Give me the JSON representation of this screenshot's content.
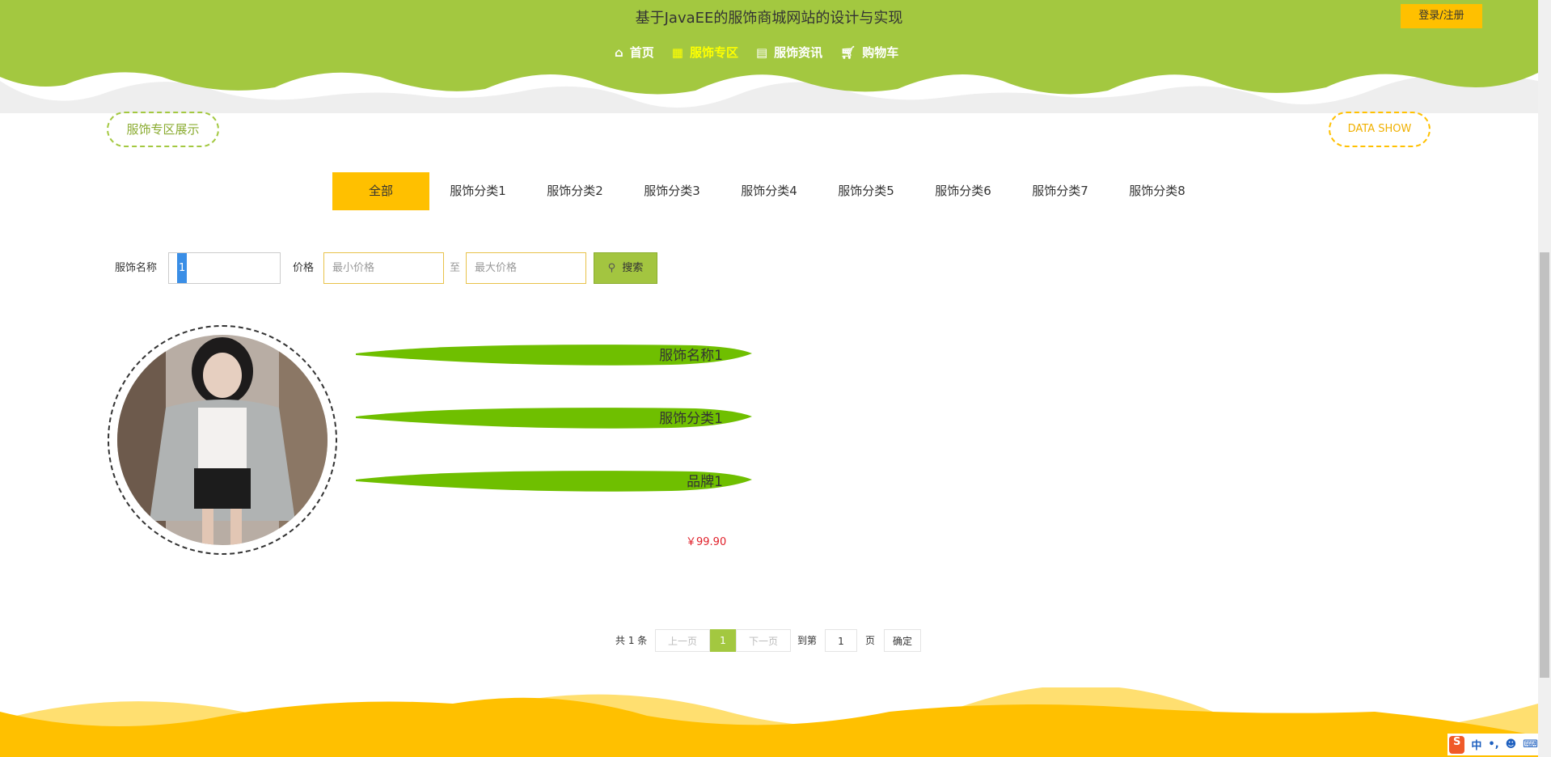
{
  "header": {
    "title": "基于JavaEE的服饰商城网站的设计与实现",
    "login": "登录/注册",
    "nav": [
      {
        "label": "首页",
        "icon": "home-icon"
      },
      {
        "label": "服饰专区",
        "icon": "grid-icon"
      },
      {
        "label": "服饰资讯",
        "icon": "news-icon"
      },
      {
        "label": "购物车",
        "icon": "cart-icon"
      }
    ]
  },
  "section": {
    "title": "服饰专区展示",
    "data_show": "DATA SHOW"
  },
  "tabs": [
    "全部",
    "服饰分类1",
    "服饰分类2",
    "服饰分类3",
    "服饰分类4",
    "服饰分类5",
    "服饰分类6",
    "服饰分类7",
    "服饰分类8"
  ],
  "search": {
    "name_label": "服饰名称",
    "name_value": "1",
    "price_label": "价格",
    "min_placeholder": "最小价格",
    "to": "至",
    "max_placeholder": "最大价格",
    "button": "搜索"
  },
  "product": {
    "name": "服饰名称1",
    "category": "服饰分类1",
    "brand": "品牌1",
    "price": "￥99.90"
  },
  "pagination": {
    "total": "共 1 条",
    "prev": "上一页",
    "current": "1",
    "next": "下一页",
    "goto": "到第",
    "page_value": "1",
    "page_unit": "页",
    "confirm": "确定"
  },
  "ime": {
    "lang": "中",
    "punct": "•,"
  },
  "colors": {
    "green": "#a3c840",
    "yellow": "#ffc000",
    "brush": "#6fbf00",
    "price": "#e0202a"
  }
}
